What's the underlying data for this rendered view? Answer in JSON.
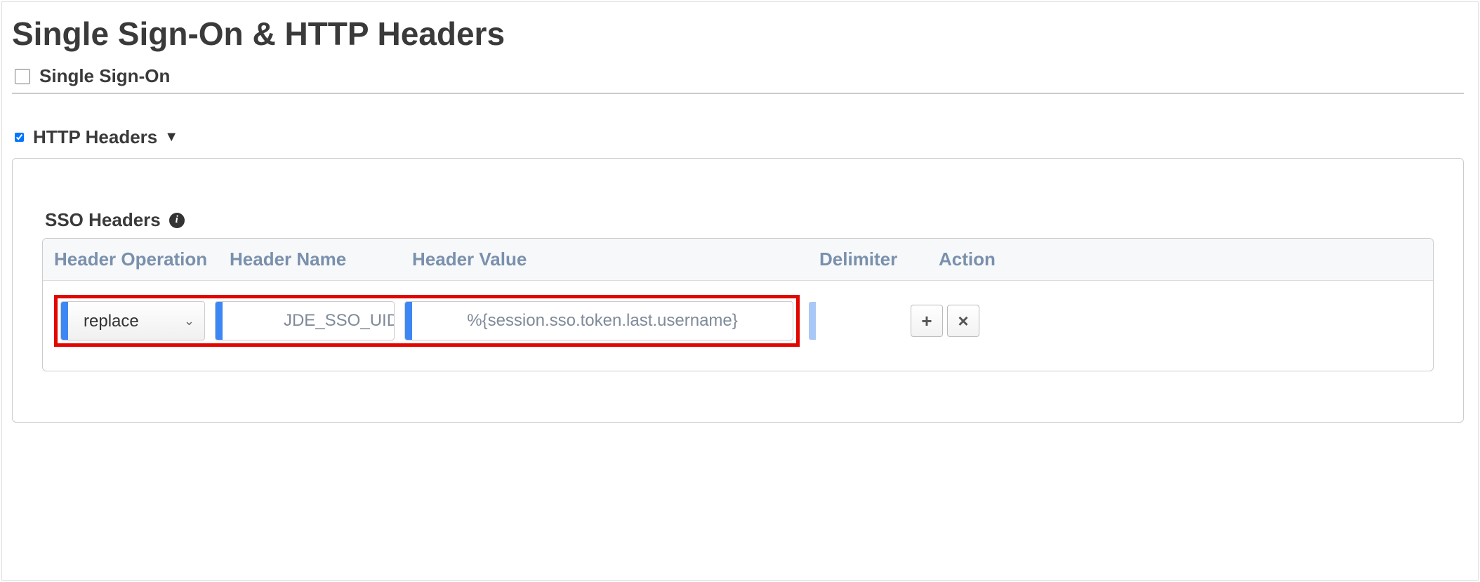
{
  "title": "Single Sign-On & HTTP Headers",
  "sso_section": {
    "label": "Single Sign-On",
    "checked": false
  },
  "http_section": {
    "label": "HTTP Headers",
    "checked": true,
    "expanded": true
  },
  "sso_headers": {
    "label": "SSO Headers",
    "columns": {
      "op": "Header Operation",
      "name": "Header Name",
      "value": "Header Value",
      "delimiter": "Delimiter",
      "action": "Action"
    },
    "row": {
      "operation": "replace",
      "name": "JDE_SSO_UID",
      "value": "%{session.sso.token.last.username}",
      "delimiter": ""
    }
  }
}
